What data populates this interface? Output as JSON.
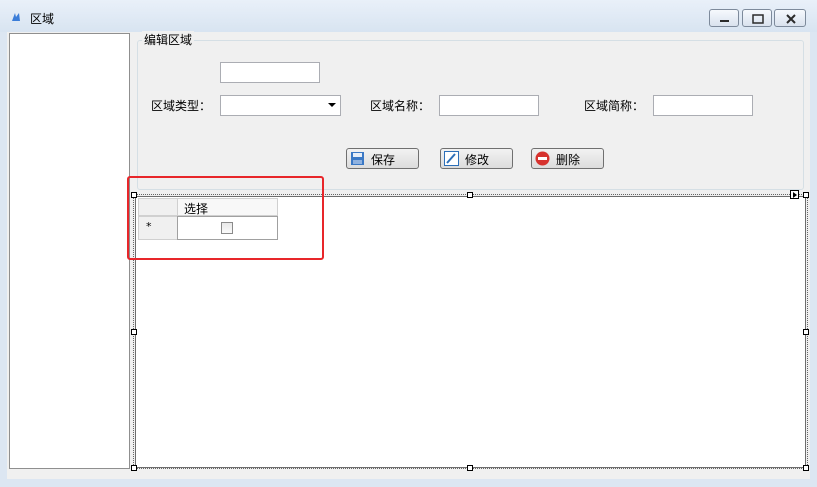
{
  "window": {
    "title": "区域"
  },
  "groupbox": {
    "title": "编辑区域"
  },
  "form": {
    "type_label": "区域类型：",
    "name_label": "区域名称：",
    "abbr_label": "区域简称：",
    "top_value": "",
    "name_value": "",
    "abbr_value": "",
    "type_value": ""
  },
  "toolbar": {
    "save_label": "保存",
    "edit_label": "修改",
    "delete_label": "删除"
  },
  "grid": {
    "columns": [
      "选择"
    ],
    "new_row_marker": "*"
  },
  "icons": {
    "app": "app-icon",
    "save": "save-icon",
    "edit": "edit-icon",
    "delete": "delete-icon",
    "dropdown": "chevron-down-icon"
  },
  "colors": {
    "highlight": "#e8262a",
    "titlebar": "#dce6f2",
    "client": "#f0f0f0"
  }
}
